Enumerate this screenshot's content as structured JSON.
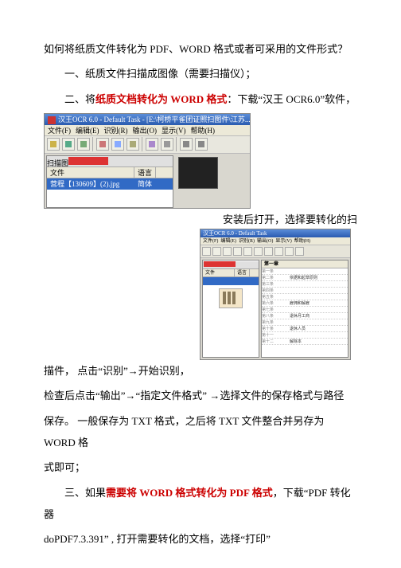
{
  "heading": "如何将纸质文件转化为 PDF、WORD 格式或者可采用的文件形式？",
  "step1": "一、纸质文件扫描成图像（需要扫描仪）；",
  "step2_prefix": "二、将",
  "step2_red": "纸质文档转化为 WORD 格式",
  "step2_suffix": "：下载“汉王 OCR6.0”软件，",
  "screenshot1": {
    "title": "汉王OCR 6.0 - Default Task - [E:\\柯桥平雀团证照扫图件\\江苏...",
    "menus": [
      "文件(F)",
      "编辑(E)",
      "识别(R)",
      "输出(O)",
      "显示(V)",
      "帮助(H)"
    ],
    "panel_tab": "扫描图",
    "col_file": "文件",
    "col_lang": "语言",
    "row_file": "营程【130609】(2).jpg",
    "row_lang": "简体"
  },
  "mid_text": "安装后打开，选择要转化的扫",
  "screenshot2": {
    "title": "汉王OCR 6.0 - Default Task",
    "menus": [
      "文件(F)",
      "编辑(E)",
      "识别(R)",
      "输出(O)",
      "显示(V)",
      "帮助(H)"
    ],
    "col_file": "文件",
    "col_lang": "语言",
    "right_header": "第一章",
    "rows": [
      "第一条",
      "第二条",
      "第三条",
      "第四条",
      "第五条",
      "第六条",
      "第七条",
      "第八条",
      "第九条",
      "第十条",
      "第十一",
      "第十二"
    ],
    "vals": [
      "",
      "依据和起草原则",
      "",
      "",
      "",
      "雇佣和解雇",
      "",
      "退休月工商",
      "",
      "退休人员",
      "",
      "解除本"
    ]
  },
  "line3a": "描件，  点击“识别”→开始识别，",
  "line3b": "检查后点击“输出”→“指定文件格式” →选择文件的保存格式与路径",
  "line3c": "保存。  一般保存为 TXT 格式，之后将 TXT 文件整合并另存为 WORD 格",
  "line3d": "式即可；",
  "step3_prefix": "三、如果",
  "step3_red": "需要将 WORD 格式转化为 PDF 格式",
  "step3_suffix": "，下载“PDF 转化器",
  "line4": "doPDF7.3.391” ,  打开需要转化的文档，选择“打印”"
}
